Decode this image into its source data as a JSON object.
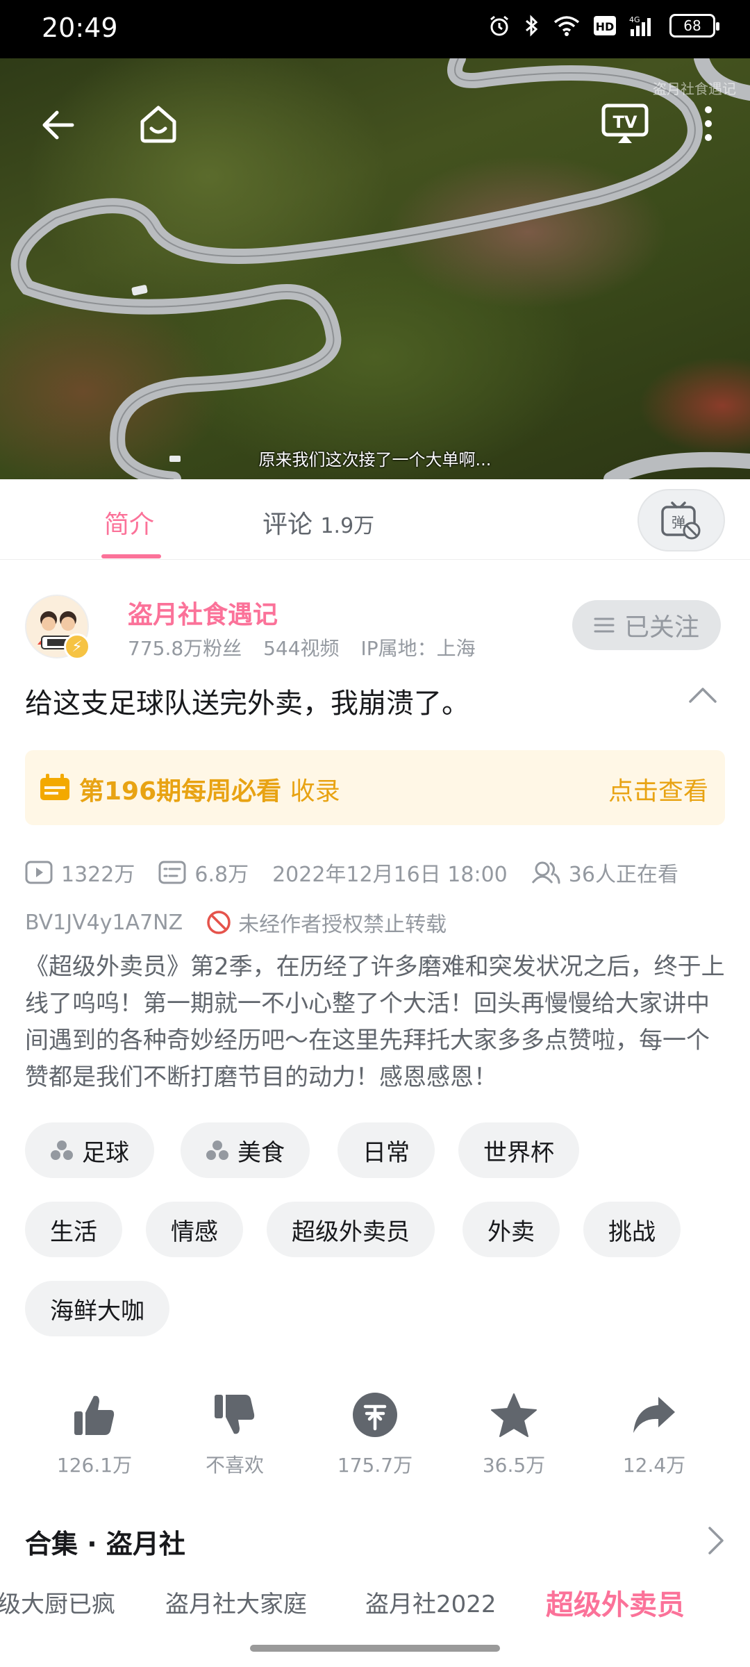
{
  "status_bar": {
    "time": "20:49",
    "battery": "68",
    "icons": [
      "alarm-icon",
      "bluetooth-icon",
      "wifi-icon",
      "hd-icon",
      "4g-signal-icon",
      "battery-icon"
    ]
  },
  "video": {
    "watermark": "盗月社食遇记",
    "subtitle": "原来我们这次接了一个大单啊...",
    "controls": [
      "back-icon",
      "home-icon",
      "tv-cast-icon",
      "more-icon"
    ]
  },
  "tabs": {
    "intro": "简介",
    "comments_label": "评论",
    "comments_count": "1.9万"
  },
  "uploader": {
    "name": "盗月社食遇记",
    "fans": "775.8万粉丝",
    "videos": "544视频",
    "ip": "IP属地：上海",
    "follow_label": "已关注"
  },
  "video_info": {
    "title": "给这支足球队送完外卖，我崩溃了。",
    "weekly_bold": "第196期每周必看",
    "weekly_light": "收录",
    "weekly_link": "点击查看",
    "views": "1322万",
    "danmaku": "6.8万",
    "publish_time": "2022年12月16日 18:00",
    "watching": "36人正在看",
    "bvid": "BV1JV4y1A7NZ",
    "copyright": "未经作者授权禁止转载",
    "description": "《超级外卖员》第2季，在历经了许多磨难和突发状况之后，终于上线了呜呜！第一期就一不小心整了个大活！回头再慢慢给大家讲中间遇到的各种奇妙经历吧～在这里先拜托大家多多点赞啦，每一个赞都是我们不断打磨节目的动力！感恩感恩！"
  },
  "tags": [
    "足球",
    "美食",
    "日常",
    "世界杯",
    "生活",
    "情感",
    "超级外卖员",
    "外卖",
    "挑战",
    "海鲜大咖"
  ],
  "actions": {
    "like": "126.1万",
    "dislike": "不喜欢",
    "coin": "175.7万",
    "favorite": "36.5万",
    "share": "12.4万"
  },
  "collection": {
    "title": "合集 · 盗月社",
    "episodes": [
      "级大厨已疯",
      "盗月社大家庭",
      "盗月社2022",
      "超级外卖员"
    ],
    "active_index": 3
  },
  "colors": {
    "accent": "#fb7299",
    "weekly_gold": "#e8a313",
    "weekly_bg": "#fff7e6",
    "muted_text": "#9499a0"
  }
}
